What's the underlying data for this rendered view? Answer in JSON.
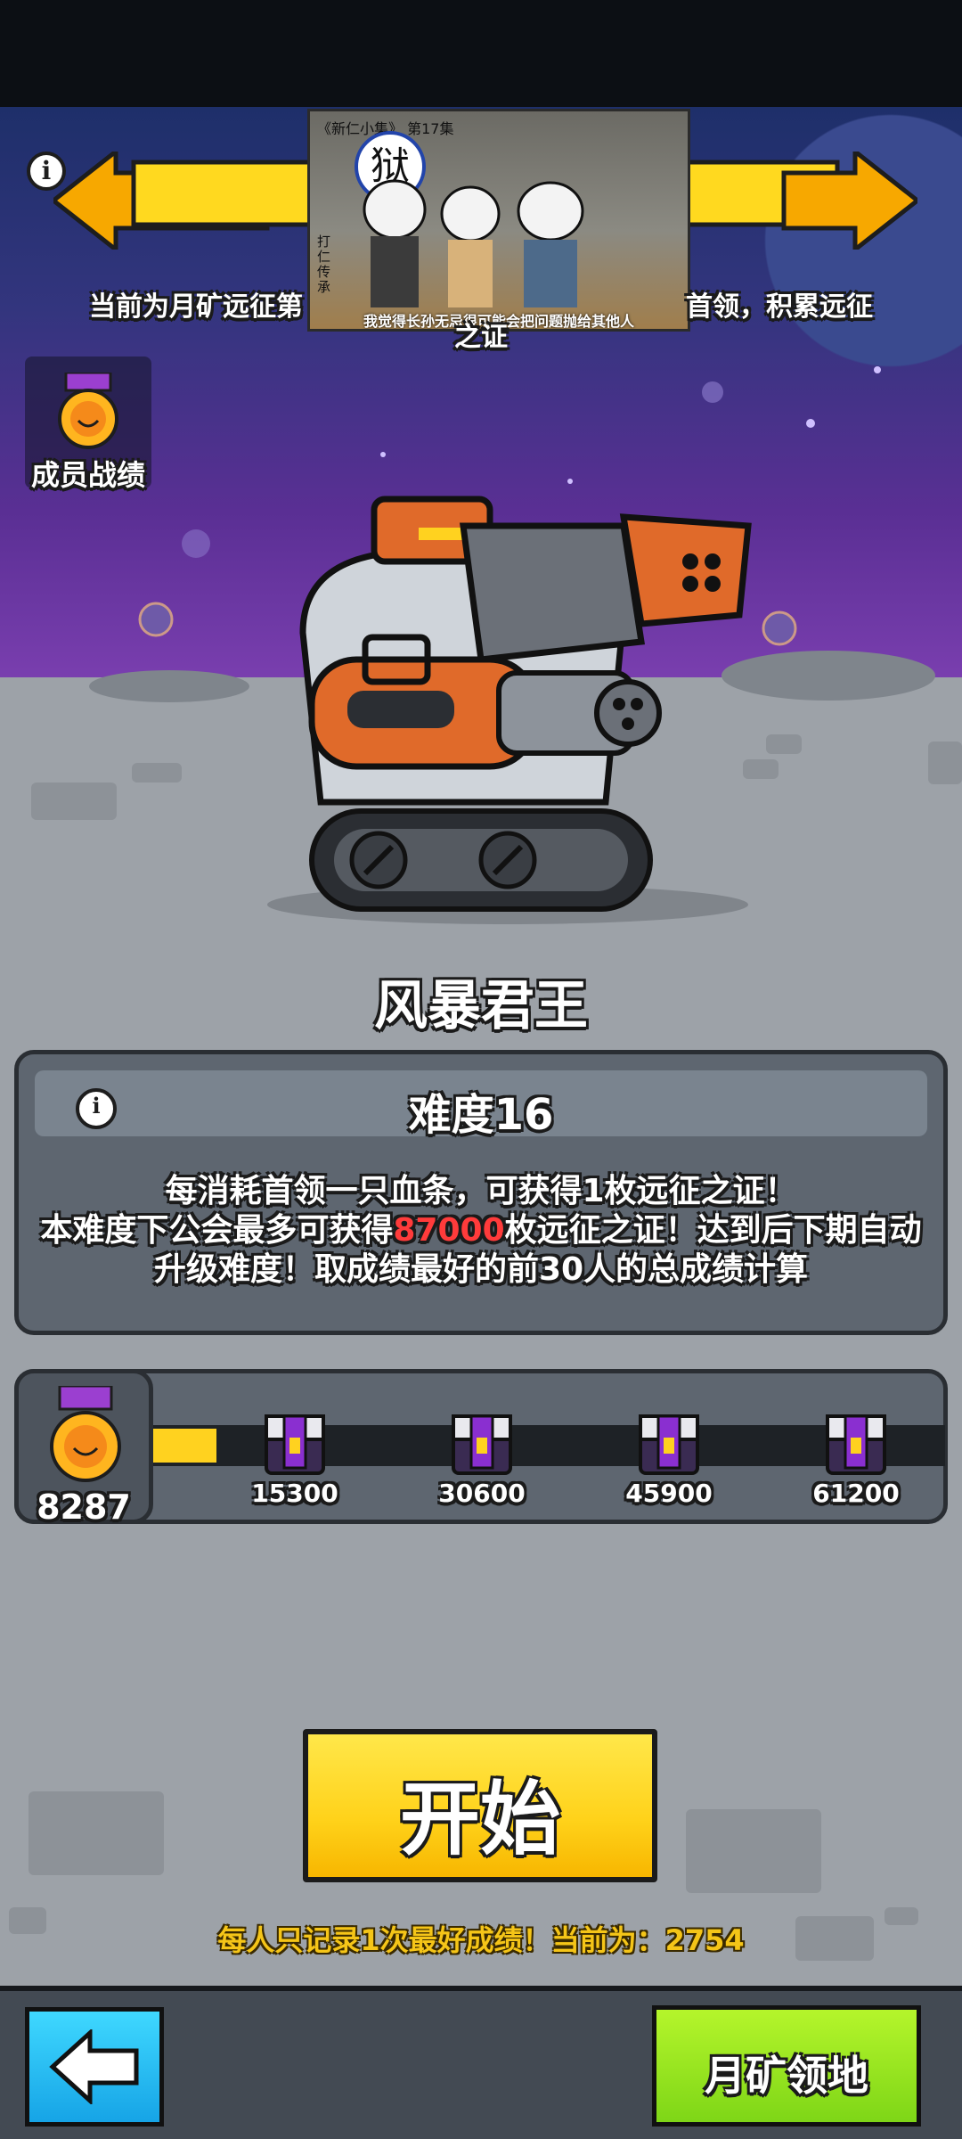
{
  "header": {
    "banner_text": "当前为月矿远征第",
    "banner_text_right": "首领，积累远征",
    "banner_text_line2": "之证",
    "info_icon": "info-icon",
    "video": {
      "title": "《新仁小集》 第17集",
      "seal_char": "狱",
      "watermark": "打仁传承",
      "caption": "我觉得长孙无忌很可能会把问题抛给其他人"
    }
  },
  "member_record": {
    "label": "成员战绩",
    "icon": "medal-icon"
  },
  "boss": {
    "name": "风暴君王"
  },
  "difficulty": {
    "label": "难度16",
    "info_icon": "info-icon",
    "description_line1": "每消耗首领一只血条，可获得1枚远征之证！",
    "description_line2_pre": "本难度下公会最多可获得",
    "description_line2_highlight": "87000",
    "description_line2_post": "枚远征之证！达到后下期自动",
    "description_line3": "升级难度！取成绩最好的前30人的总成绩计算"
  },
  "progress": {
    "current": "8287",
    "max_value": 87000,
    "current_value": 8287,
    "milestones": [
      {
        "label": "15300",
        "icon": "chest-icon"
      },
      {
        "label": "30600",
        "icon": "chest-icon"
      },
      {
        "label": "45900",
        "icon": "chest-icon"
      },
      {
        "label": "61200",
        "icon": "chest-icon"
      }
    ]
  },
  "start_button": {
    "label": "开始"
  },
  "record_note": "每人只记录1次最好成绩！当前为：2754",
  "bottom": {
    "back_icon": "back-arrow-icon",
    "moon_land_label": "月矿领地"
  },
  "colors": {
    "accent_yellow": "#ffd21f",
    "highlight_red": "#ff3b3b",
    "chest_purple": "#7a2fb8",
    "green_button": "#8fe21c",
    "blue_button": "#1fb8f2"
  }
}
